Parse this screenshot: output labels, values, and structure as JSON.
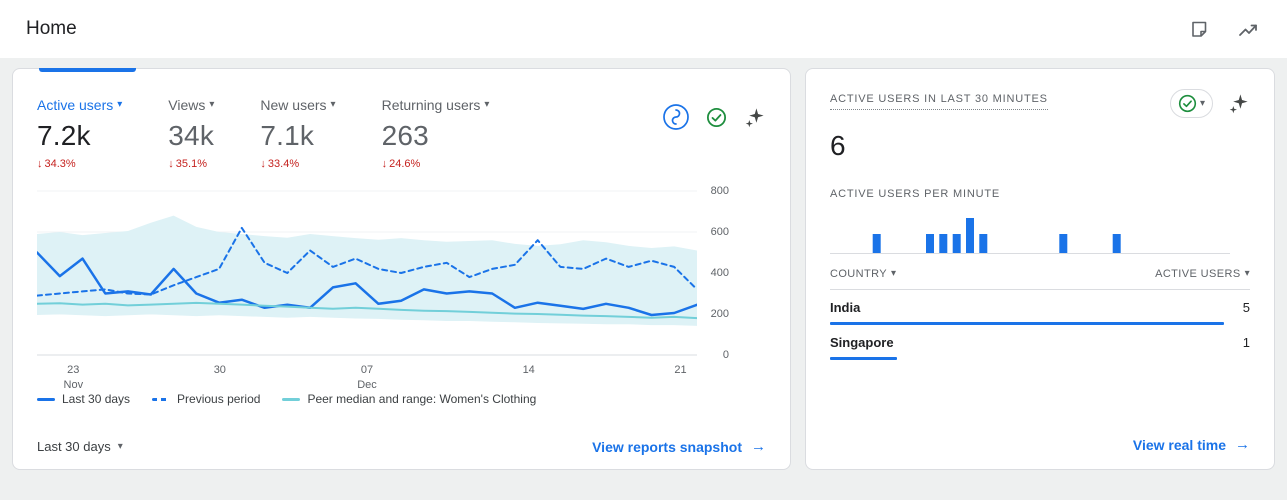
{
  "header": {
    "title": "Home"
  },
  "icons": {
    "caret_down": "▾",
    "arrow_down": "↓",
    "arrow_right": "→"
  },
  "left_card": {
    "metrics": [
      {
        "label": "Active users",
        "value": "7.2k",
        "delta": "34.3%"
      },
      {
        "label": "Views",
        "value": "34k",
        "delta": "35.1%"
      },
      {
        "label": "New users",
        "value": "7.1k",
        "delta": "33.4%"
      },
      {
        "label": "Returning users",
        "value": "263",
        "delta": "24.6%"
      }
    ],
    "legend": [
      {
        "label": "Last 30 days"
      },
      {
        "label": "Previous period"
      },
      {
        "label": "Peer median and range: Women's Clothing"
      }
    ],
    "range_label": "Last 30 days",
    "link_label": "View reports snapshot"
  },
  "right_card": {
    "title": "ACTIVE USERS IN LAST 30 MINUTES",
    "active_users_count": "6",
    "per_minute_label": "ACTIVE USERS PER MINUTE",
    "table": {
      "col_country": "COUNTRY",
      "col_users": "ACTIVE USERS",
      "rows": [
        {
          "country": "India",
          "users": "5",
          "fraction": 1
        },
        {
          "country": "Singapore",
          "users": "1",
          "fraction": 0.17
        }
      ]
    },
    "link_label": "View real time"
  },
  "colors": {
    "accent_blue": "#1a73e8",
    "negative_red": "#c5221f",
    "success_green": "#1e8e3e",
    "peer_line_teal": "#72cfd9",
    "peer_band_teal": "#def2f6",
    "grid_gray": "#f1f3f4",
    "axis_gray": "#dadce0"
  },
  "chart_data": [
    {
      "type": "line",
      "title": "Active users trend (Nov 23 - Dec 21)",
      "ylim": [
        0,
        800
      ],
      "yticks": [
        0,
        200,
        400,
        600,
        800
      ],
      "x_tick_labels": [
        {
          "label": "23",
          "sub": "Nov",
          "pos": 0.055
        },
        {
          "label": "30",
          "sub": "",
          "pos": 0.277
        },
        {
          "label": "07",
          "sub": "Dec",
          "pos": 0.5
        },
        {
          "label": "14",
          "sub": "",
          "pos": 0.745
        },
        {
          "label": "21",
          "sub": "",
          "pos": 0.975
        }
      ],
      "series": [
        {
          "name": "Last 30 days",
          "style": "solid",
          "color": "#1a73e8",
          "width": 2.5,
          "values": [
            500,
            385,
            470,
            300,
            310,
            295,
            420,
            300,
            255,
            270,
            230,
            245,
            230,
            330,
            350,
            250,
            265,
            320,
            300,
            310,
            300,
            230,
            255,
            240,
            225,
            250,
            230,
            195,
            205,
            245
          ]
        },
        {
          "name": "Previous period",
          "style": "dashed",
          "color": "#1a73e8",
          "width": 2,
          "values": [
            290,
            300,
            310,
            320,
            300,
            295,
            340,
            380,
            420,
            620,
            450,
            400,
            510,
            430,
            470,
            420,
            400,
            430,
            450,
            380,
            420,
            440,
            560,
            430,
            420,
            470,
            430,
            460,
            430,
            320
          ]
        },
        {
          "name": "Peer median: Women's Clothing",
          "style": "solid",
          "color": "#72cfd9",
          "width": 2,
          "values": [
            250,
            252,
            246,
            250,
            242,
            246,
            250,
            254,
            250,
            246,
            240,
            236,
            230,
            226,
            230,
            226,
            220,
            216,
            214,
            210,
            206,
            202,
            200,
            196,
            192,
            190,
            186,
            182,
            186,
            180
          ]
        }
      ],
      "band": {
        "name": "Peer range: Women's Clothing",
        "color": "#def2f6",
        "upper": [
          590,
          600,
          585,
          595,
          605,
          645,
          680,
          625,
          600,
          590,
          580,
          572,
          590,
          580,
          570,
          562,
          570,
          560,
          552,
          556,
          560,
          542,
          532,
          540,
          560,
          550,
          532,
          522,
          530,
          510
        ],
        "lower": [
          195,
          198,
          194,
          190,
          194,
          198,
          194,
          190,
          194,
          190,
          186,
          182,
          186,
          182,
          178,
          176,
          172,
          170,
          166,
          166,
          162,
          160,
          156,
          154,
          152,
          150,
          150,
          146,
          146,
          142
        ]
      },
      "legend_position": "bottom"
    },
    {
      "type": "bar",
      "title": "Active users per minute (last 30 minutes)",
      "color": "#1a73e8",
      "values": [
        0,
        0,
        0,
        1,
        0,
        0,
        0,
        1,
        1,
        1,
        2,
        1,
        0,
        0,
        0,
        0,
        0,
        1,
        0,
        0,
        0,
        1,
        0,
        0,
        0,
        0,
        0,
        0,
        0,
        0
      ]
    }
  ]
}
